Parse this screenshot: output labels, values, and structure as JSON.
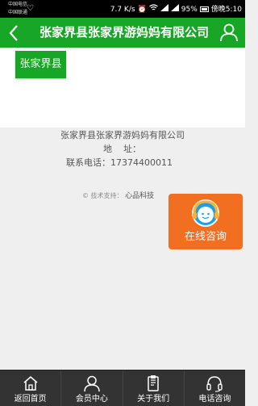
{
  "status_bar": {
    "carrier_line1": "中国电信",
    "carrier_line2": "中国联通",
    "speed": "7.7 K/s",
    "battery": "95%",
    "time": "傍晚5:10"
  },
  "header": {
    "title": "张家界县张家界游妈妈有限公司"
  },
  "content": {
    "region_button": "张家界县"
  },
  "info": {
    "company": "张家界县张家界游妈妈有限公司",
    "address": "地    址：",
    "phone": "联系电话：17374400011"
  },
  "support": {
    "prefix": "© 技术支持：",
    "brand": "心品科技"
  },
  "consult": {
    "label": "在线咨询"
  },
  "tabbar": {
    "tabs": [
      {
        "label": "返回首页",
        "icon": "home-icon"
      },
      {
        "label": "会员中心",
        "icon": "member-icon"
      },
      {
        "label": "关于我们",
        "icon": "about-icon"
      },
      {
        "label": "电话咨询",
        "icon": "headset-icon"
      }
    ]
  },
  "colors": {
    "brand_green": "#18a626",
    "consult_orange": "#f26f21",
    "tabbar_bg": "#333333"
  }
}
